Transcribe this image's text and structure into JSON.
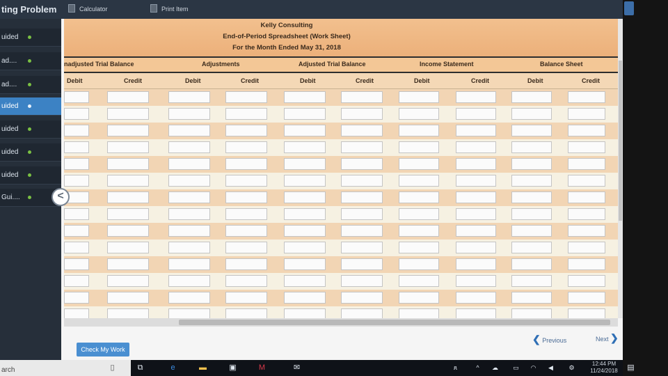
{
  "app": {
    "title": "ting Problem",
    "tools": {
      "calculator": "Calculator",
      "print": "Print Item"
    }
  },
  "sidebar": {
    "items": [
      {
        "label": "uided",
        "active": false
      },
      {
        "label": "ad....",
        "active": false
      },
      {
        "label": "ad....",
        "active": false
      },
      {
        "label": "uided",
        "active": true
      },
      {
        "label": "uided",
        "active": false
      },
      {
        "label": "uided",
        "active": false
      },
      {
        "label": "uided",
        "active": false
      },
      {
        "label": "Gui....",
        "active": false
      }
    ],
    "collapse_glyph": "<"
  },
  "worksheet": {
    "company": "Kelly Consulting",
    "title": "End-of-Period Spreadsheet (Work Sheet)",
    "period": "For the Month Ended May 31, 2018",
    "groups": [
      "nadjusted Trial Balance",
      "Adjustments",
      "Adjusted Trial Balance",
      "Income Statement",
      "Balance Sheet"
    ],
    "columns": [
      "Debit",
      "Credit",
      "Debit",
      "Credit",
      "Debit",
      "Credit",
      "Debit",
      "Credit",
      "Debit",
      "Credit"
    ],
    "row_count": 14
  },
  "footer": {
    "check_button": "Check My Work",
    "previous": "Previous",
    "next": "Next",
    "prev_glyph": "❮",
    "next_glyph": "❯"
  },
  "taskbar": {
    "search": "arch",
    "time": "12:44 PM",
    "date": "11/24/2018"
  },
  "colors": {
    "header_band": "#ecb07a",
    "row_even": "#f2d5b4",
    "row_odd": "#f6f1e2",
    "sidebar_active": "#3c82c4",
    "check_button": "#4a8fd1"
  }
}
